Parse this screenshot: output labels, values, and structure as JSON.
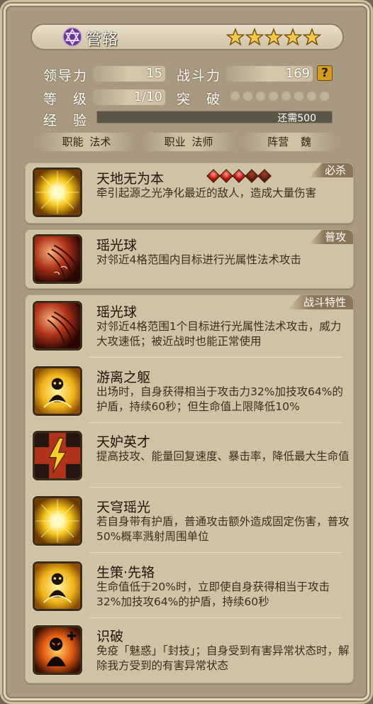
{
  "hero": {
    "name": "管辂",
    "stars": 5,
    "faction_icon": "hexagram-icon"
  },
  "stats": {
    "leadership_label": "领导力",
    "leadership_value": "15",
    "power_label": "战斗力",
    "power_value": "169",
    "help_label": "?",
    "level_label": "等　级",
    "level_value": "1/10",
    "breakthrough_label": "突　破",
    "breakthrough_total": 8,
    "breakthrough_filled": 0,
    "exp_label": "经　验",
    "exp_text": "还需500",
    "exp_fraction": 0.0
  },
  "tags": {
    "job_label": "职能",
    "job_value": "法术",
    "class_label": "职业",
    "class_value": "法师",
    "camp_label": "阵营",
    "camp_value": "魏"
  },
  "cards": {
    "ultimate": {
      "badge": "必杀",
      "name": "天地无为本",
      "desc": "牵引起源之光净化最近的敌人，造成大量伤害",
      "gems_red": 3,
      "gems_total": 5
    },
    "normal": {
      "badge": "普攻",
      "name": "瑶光球",
      "desc": "对邻近4格范围内目标进行光属性法术攻击"
    },
    "traits": {
      "badge": "战斗特性",
      "items": [
        {
          "name": "瑶光球",
          "desc": "对邻近4格范围1个目标进行光属性法术攻击，威力大攻速低；被近战时也能正常使用",
          "icon": "light-orb-icon"
        },
        {
          "name": "游离之躯",
          "desc": "出场时，自身获得相当于攻击力32%加技攻64%的护盾，持续60秒；但生命值上限降低10%",
          "icon": "shield-figure-icon"
        },
        {
          "name": "天妒英才",
          "desc": "提高技攻、能量回复速度、暴击率，降低最大生命值",
          "icon": "lightning-icon"
        },
        {
          "name": "天穹瑶光",
          "desc": "若自身带有护盾，普通攻击额外造成固定伤害，普攻50%概率溅射周围单位",
          "icon": "radiant-sun-icon"
        },
        {
          "name": "生策·先辂",
          "desc": "生命值低于20%时，立即使自身获得相当于攻击32%加技攻64%的护盾，持续60秒",
          "icon": "shield-figure-icon"
        },
        {
          "name": "识破",
          "desc": "免疫「魅惑」「封技」；自身受到有害异常状态时，解除我方受到的有害异常状态",
          "icon": "immunity-figure-icon"
        }
      ]
    }
  },
  "colors": {
    "panel": "#a79a80",
    "card": "#cfc3a5",
    "badge": "#8a7658",
    "star": "#f2c94c"
  }
}
